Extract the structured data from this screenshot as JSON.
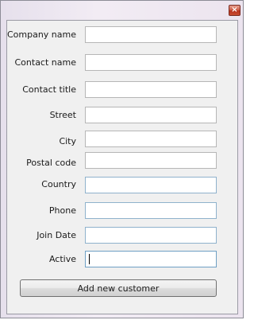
{
  "window": {
    "title": "",
    "close_glyph": "×",
    "close_icon": "close-icon"
  },
  "form": {
    "fields": [
      {
        "label": "Company name",
        "value": ""
      },
      {
        "label": "Contact name",
        "value": ""
      },
      {
        "label": "Contact title",
        "value": ""
      },
      {
        "label": "Street",
        "value": ""
      },
      {
        "label": "City",
        "value": ""
      },
      {
        "label": "Postal code",
        "value": ""
      },
      {
        "label": "Country",
        "value": ""
      },
      {
        "label": "Phone",
        "value": ""
      },
      {
        "label": "Join Date",
        "value": ""
      },
      {
        "label": "Active",
        "value": ""
      }
    ],
    "submit_label": "Add new customer"
  },
  "colors": {
    "close_button": "#c8442e",
    "client_background": "#f0f0f0",
    "field_border": "#b6b6b6",
    "field_border_blue": "#8fb2cc"
  }
}
